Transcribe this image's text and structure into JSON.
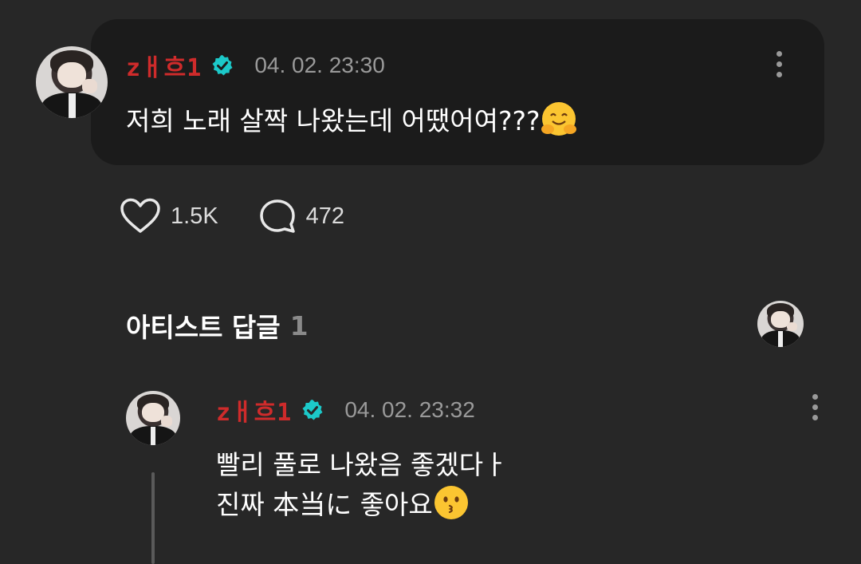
{
  "post": {
    "username": "zㅐ흐1",
    "timestamp": "04. 02. 23:30",
    "text": "저희 노래 살짝 나왔는데 어땠어여???",
    "emoji": "hugging-face-emoji",
    "likes": "1.5K",
    "comments": "472"
  },
  "artist_replies": {
    "title": "아티스트 답글",
    "count": "1"
  },
  "reply": {
    "username": "zㅐ흐1",
    "timestamp": "04. 02. 23:32",
    "line1": "빨리 풀로 나왔음 좋겠다ㅏ",
    "line2": "진짜 本当に 좋아요",
    "emoji": "kissing-face-emoji"
  },
  "colors": {
    "background": "#272727",
    "card": "#1b1b1b",
    "username": "#cf2b2b",
    "verified": "#1cc9c9"
  }
}
